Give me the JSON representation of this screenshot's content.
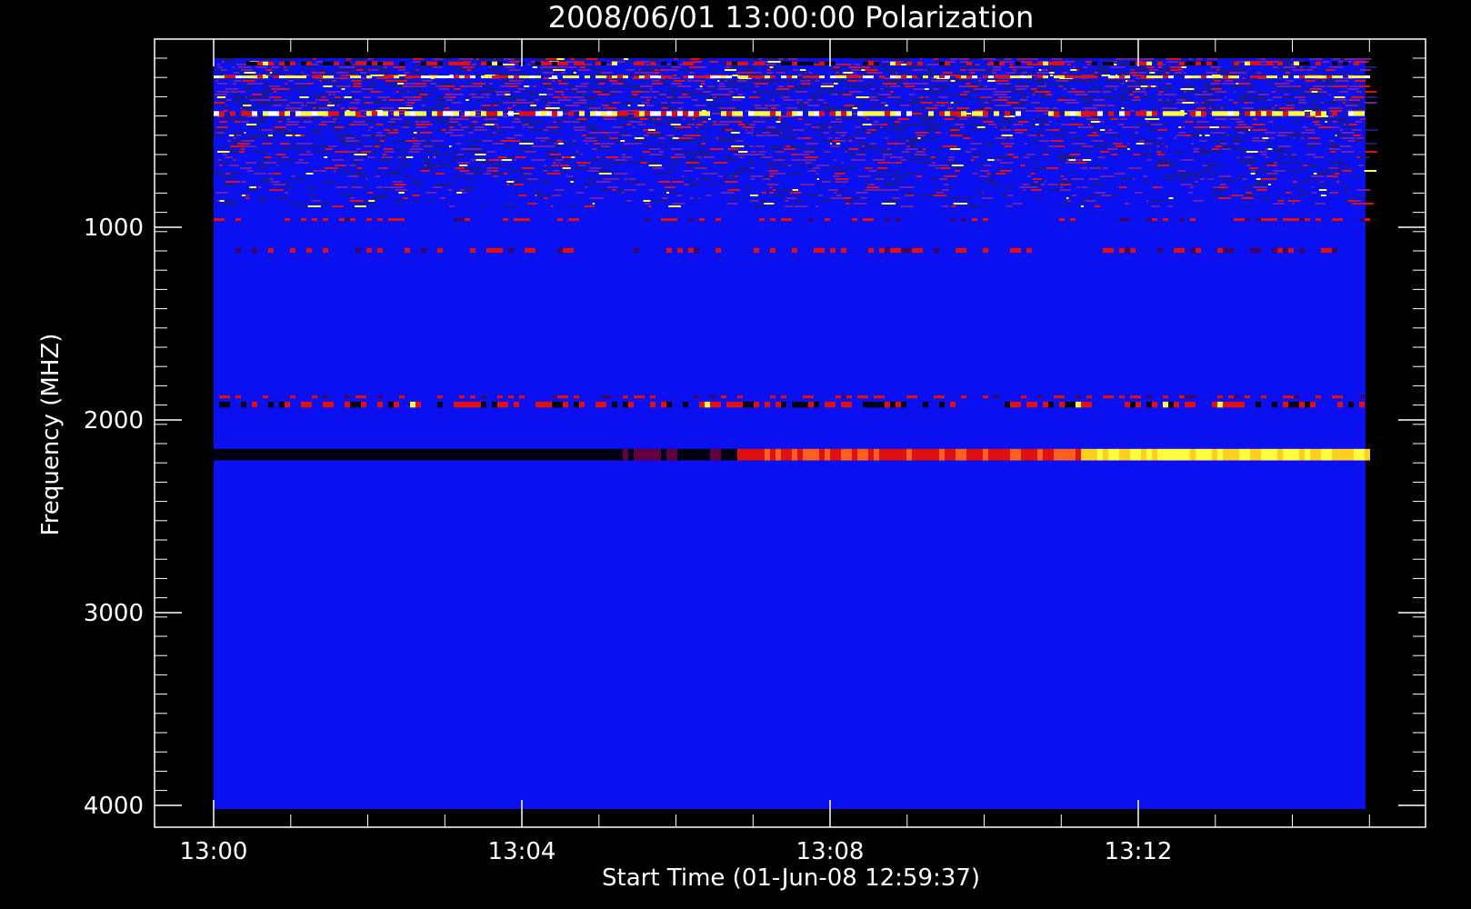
{
  "chart_data": {
    "type": "heatmap",
    "title": "2008/06/01  13:00:00 Polarization",
    "xlabel": "Start Time (01-Jun-08 12:59:37)",
    "ylabel": "Frequency (MHZ)",
    "x_tick_labels": [
      "13:00",
      "13:04",
      "13:08",
      "13:12"
    ],
    "y_tick_labels": [
      "1000",
      "2000",
      "3000",
      "4000"
    ],
    "x_range_minutes": [
      0,
      15
    ],
    "y_range_mhz": [
      100,
      4000
    ],
    "y_axis_inverted": true,
    "colormap": {
      "background": "#0a10f0",
      "dark": "#000010",
      "mid": "#e01010",
      "bright": "#ffff40"
    },
    "frame_color": "#ffffff",
    "page_background": "#000000",
    "features": [
      {
        "kind": "band",
        "freq_mhz": 150,
        "width_mhz": 20,
        "intensity": "mixed"
      },
      {
        "kind": "band",
        "freq_mhz": 220,
        "width_mhz": 10,
        "intensity": "bright"
      },
      {
        "kind": "band",
        "freq_mhz": 410,
        "width_mhz": 25,
        "intensity": "bright"
      },
      {
        "kind": "band",
        "freq_mhz": 960,
        "width_mhz": 15,
        "intensity": "mid"
      },
      {
        "kind": "band",
        "freq_mhz": 1120,
        "width_mhz": 25,
        "intensity": "mid"
      },
      {
        "kind": "band",
        "freq_mhz": 1880,
        "width_mhz": 15,
        "intensity": "mid"
      },
      {
        "kind": "band",
        "freq_mhz": 1920,
        "width_mhz": 30,
        "intensity": "mixed"
      },
      {
        "kind": "band",
        "freq_mhz": 2180,
        "width_mhz": 60,
        "intensity": "ramp_dark_to_bright"
      }
    ]
  }
}
